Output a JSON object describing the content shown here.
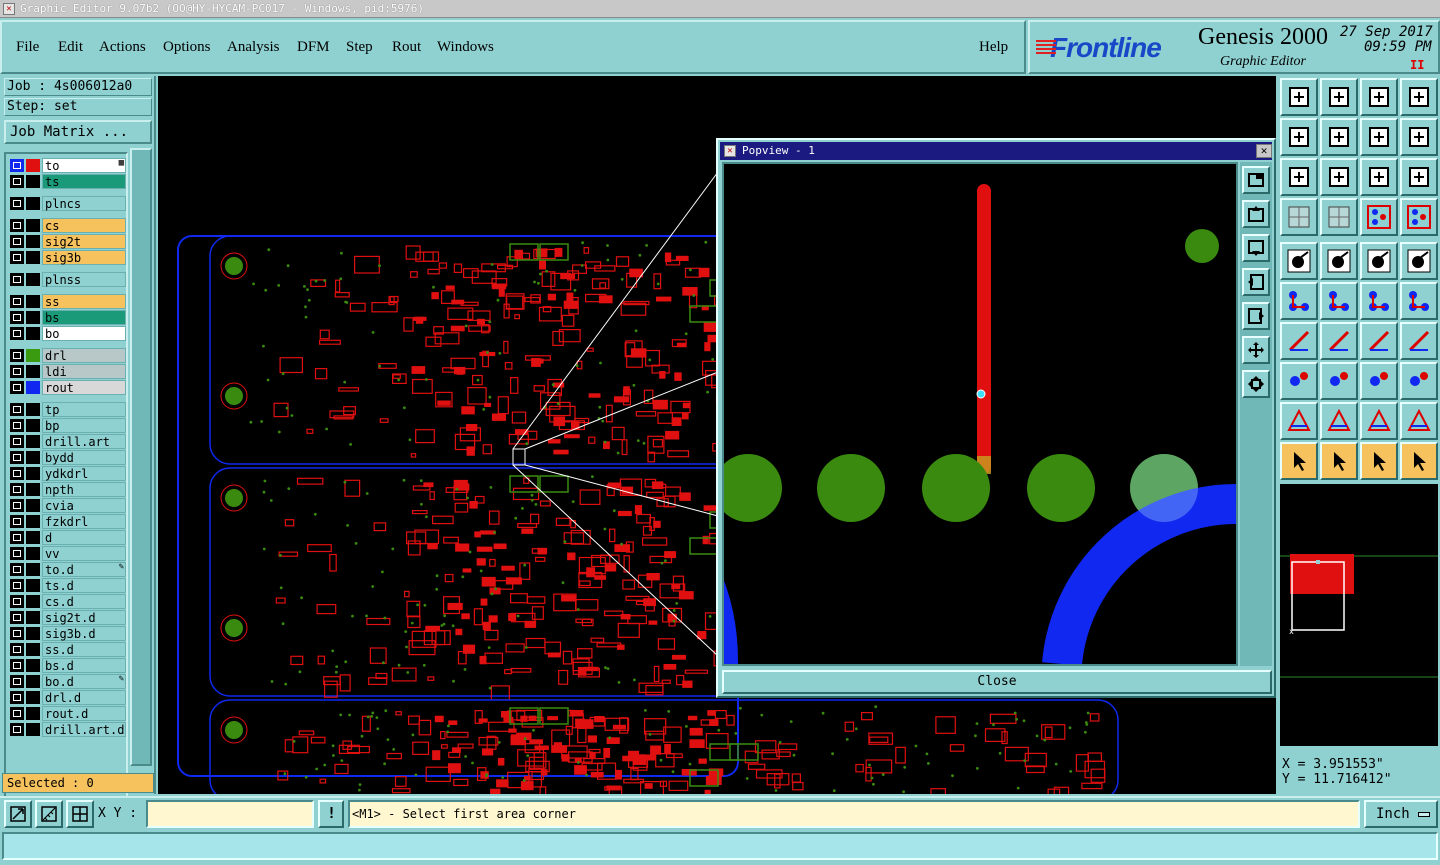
{
  "window": {
    "title": "Graphic Editor 9.07b2 (OO@HY-HYCAM-PC017 - Windows, pid:5976)"
  },
  "menu": [
    "File",
    "Edit",
    "Actions",
    "Options",
    "Analysis",
    "DFM",
    "Step",
    "Rout",
    "Windows"
  ],
  "help": "Help",
  "brand": {
    "logo": "Frontline",
    "product": "Genesis 2000",
    "subtitle": "Graphic Editor",
    "date": "27 Sep 2017",
    "time": "09:59 PM",
    "pause": "II"
  },
  "job": {
    "job_label": "Job : 4s006012a0",
    "step_label": "Step: set",
    "matrix_button": "Job Matrix ..."
  },
  "layers": [
    {
      "name": "to",
      "color": "#e01010",
      "bg": "#ffffff",
      "active": true,
      "flag": "▦"
    },
    {
      "name": "ts",
      "color": "#000000",
      "bg": "#1a9a78"
    },
    {
      "name": "plncs",
      "color": "#000000",
      "bg": "#8fd0d0"
    },
    {
      "name": "cs",
      "color": "#000000",
      "bg": "#f6c25e"
    },
    {
      "name": "sig2t",
      "color": "#000000",
      "bg": "#f6c25e"
    },
    {
      "name": "sig3b",
      "color": "#000000",
      "bg": "#f6c25e"
    },
    {
      "name": "plnss",
      "color": "#000000",
      "bg": "#8fd0d0"
    },
    {
      "name": "ss",
      "color": "#000000",
      "bg": "#f6c25e"
    },
    {
      "name": "bs",
      "color": "#000000",
      "bg": "#1a9a78"
    },
    {
      "name": "bo",
      "color": "#000000",
      "bg": "#ffffff"
    },
    {
      "name": "drl",
      "color": "#3a9a10",
      "bg": "#b8c8c8"
    },
    {
      "name": "ldi",
      "color": "#000000",
      "bg": "#b8c8c8"
    },
    {
      "name": "rout",
      "color": "#1028f0",
      "bg": "#d8d8d8"
    },
    {
      "name": "tp",
      "color": "#000000",
      "bg": "#8fd0d0"
    },
    {
      "name": "bp",
      "color": "#000000",
      "bg": "#8fd0d0"
    },
    {
      "name": "drill.art",
      "color": "#000000",
      "bg": "#8fd0d0"
    },
    {
      "name": "bydd",
      "color": "#000000",
      "bg": "#8fd0d0"
    },
    {
      "name": "ydkdrl",
      "color": "#000000",
      "bg": "#8fd0d0"
    },
    {
      "name": "npth",
      "color": "#000000",
      "bg": "#8fd0d0"
    },
    {
      "name": "cvia",
      "color": "#000000",
      "bg": "#8fd0d0"
    },
    {
      "name": "fzkdrl",
      "color": "#000000",
      "bg": "#8fd0d0"
    },
    {
      "name": "d",
      "color": "#000000",
      "bg": "#8fd0d0"
    },
    {
      "name": "vv",
      "color": "#000000",
      "bg": "#8fd0d0"
    },
    {
      "name": "to.d",
      "color": "#000000",
      "bg": "#8fd0d0",
      "flag": "✎"
    },
    {
      "name": "ts.d",
      "color": "#000000",
      "bg": "#8fd0d0"
    },
    {
      "name": "cs.d",
      "color": "#000000",
      "bg": "#8fd0d0"
    },
    {
      "name": "sig2t.d",
      "color": "#000000",
      "bg": "#8fd0d0"
    },
    {
      "name": "sig3b.d",
      "color": "#000000",
      "bg": "#8fd0d0"
    },
    {
      "name": "ss.d",
      "color": "#000000",
      "bg": "#8fd0d0"
    },
    {
      "name": "bs.d",
      "color": "#000000",
      "bg": "#8fd0d0"
    },
    {
      "name": "bo.d",
      "color": "#000000",
      "bg": "#8fd0d0",
      "flag": "✎"
    },
    {
      "name": "drl.d",
      "color": "#000000",
      "bg": "#8fd0d0"
    },
    {
      "name": "rout.d",
      "color": "#000000",
      "bg": "#8fd0d0"
    },
    {
      "name": "drill.art.d",
      "color": "#000000",
      "bg": "#8fd0d0"
    }
  ],
  "selected": "Selected : 0",
  "popview": {
    "title": "Popview - 1",
    "close_x": "✕",
    "close_button": "Close"
  },
  "coords": {
    "x": "X = 3.951553\"",
    "y": "Y = 11.716412\""
  },
  "bottom": {
    "xy_label": "X Y :",
    "xy_value": "",
    "alert": "!",
    "message": "<M1> - Select first area corner",
    "unit": "Inch"
  },
  "colors": {
    "panel": "#8fd0d0",
    "pad": "#3a8a10",
    "trace": "#e01010",
    "outline": "#1028f0",
    "highlight": "#f6c25e"
  }
}
